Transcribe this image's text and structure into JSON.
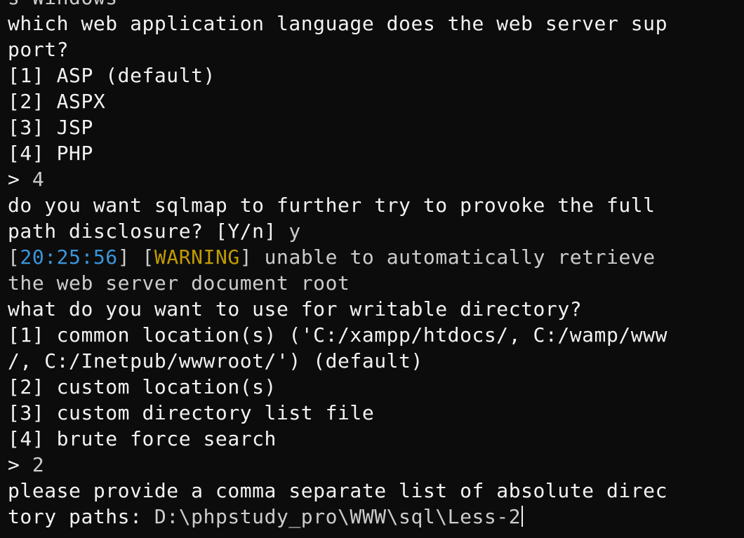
{
  "terminal": {
    "colors": {
      "background": "#0c0c0c",
      "prompt_text": "#f2f2f2",
      "log_text": "#cccccc",
      "timestamp": "#3a96dd",
      "warning_tag": "#c19c00"
    },
    "lines": {
      "l0": "s Windows",
      "l1": "which web application language does the web server sup",
      "l2": "port?",
      "l3": "[1] ASP (default)",
      "l4": "[2] ASPX",
      "l5": "[3] JSP",
      "l6": "[4] PHP",
      "l7_prompt": ">",
      "l7_answer": "4",
      "l8": "do you want sqlmap to further try to provoke the full",
      "l9_text": "path disclosure? [Y/n]",
      "l9_answer": "y",
      "l10_open1": "[",
      "l10_time": "20:25:56",
      "l10_close1": "] [",
      "l10_level": "WARNING",
      "l10_close2": "]",
      "l10_msg": "unable to automatically retrieve",
      "l11": "the web server document root",
      "l12": "what do you want to use for writable directory?",
      "l13": "[1] common location(s) ('C:/xampp/htdocs/, C:/wamp/www",
      "l14": "/, C:/Inetpub/wwwroot/') (default)",
      "l15": "[2] custom location(s)",
      "l16": "[3] custom directory list file",
      "l17": "[4] brute force search",
      "l18_prompt": ">",
      "l18_answer": "2",
      "l19": "please provide a comma separate list of absolute direc",
      "l20_text": "tory paths:",
      "l20_input": "D:\\phpstudy_pro\\WWW\\sql\\Less-2"
    }
  }
}
